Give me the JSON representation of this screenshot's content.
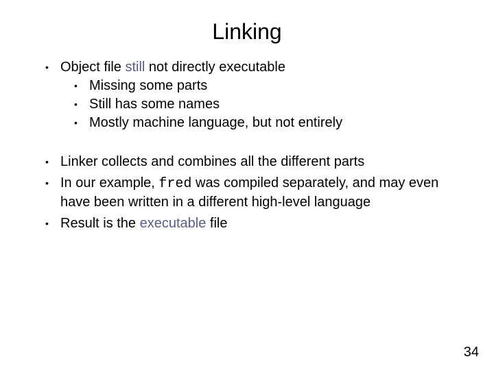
{
  "title": "Linking",
  "bullets": {
    "b1": {
      "pre": "Object file ",
      "em": "still",
      "post": " not directly executable",
      "sub": [
        "Missing some parts",
        "Still has some names",
        "Mostly machine language, but not entirely"
      ]
    },
    "b2": "Linker collects and combines all the different parts",
    "b3": {
      "pre": "In our example, ",
      "code": "fred",
      "post": " was compiled separately, and may even have been written in a different high-level language"
    },
    "b4": {
      "pre": "Result is the ",
      "em": "executable",
      "post": " file"
    }
  },
  "page_number": "34",
  "colors": {
    "accent": "#5b5b8a"
  }
}
